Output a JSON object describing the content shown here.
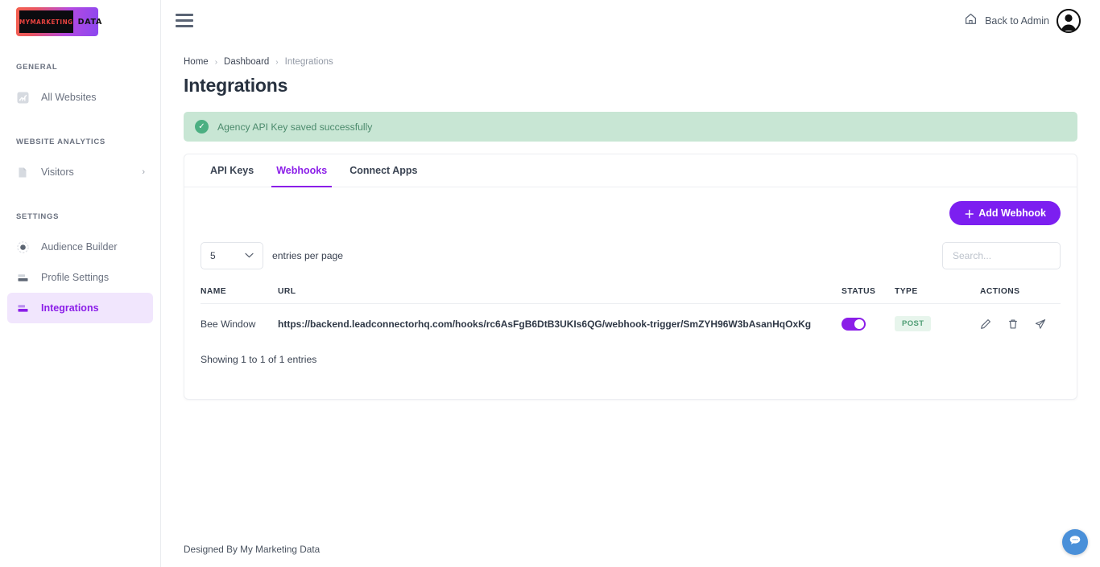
{
  "sidebar": {
    "logo": {
      "text_left": "MYMARKETING",
      "text_right": "DATA",
      "icon": "brand-logo"
    },
    "sections": [
      {
        "label": "GENERAL"
      },
      {
        "label": "WEBSITE ANALYTICS"
      },
      {
        "label": "SETTINGS"
      }
    ],
    "items": [
      {
        "label": "All Websites",
        "icon": "chart-icon",
        "active": false,
        "chevron": false
      },
      {
        "label": "Visitors",
        "icon": "page-icon",
        "active": false,
        "chevron": true
      },
      {
        "label": "Audience Builder",
        "icon": "target-icon",
        "active": false,
        "chevron": false
      },
      {
        "label": "Profile Settings",
        "icon": "profile-icon",
        "active": false,
        "chevron": false
      },
      {
        "label": "Integrations",
        "icon": "integrations-icon",
        "active": true,
        "chevron": false
      }
    ],
    "chevron_glyph": "›"
  },
  "topbar": {
    "menu_icon": "hamburger-icon",
    "back_to_admin": "Back to Admin",
    "home_icon": "home-icon",
    "avatar_icon": "user-avatar"
  },
  "breadcrumb": {
    "items": [
      {
        "label": "Home",
        "current": false
      },
      {
        "label": "Dashboard",
        "current": false
      },
      {
        "label": "Integrations",
        "current": true
      }
    ],
    "separator": "›"
  },
  "page": {
    "title": "Integrations"
  },
  "alert": {
    "message": "Agency API Key saved successfully",
    "icon": "check-circle-icon",
    "check_glyph": "✓",
    "bg_color": "#c8e6d4",
    "text_color": "#4b8a6c"
  },
  "tabs": [
    {
      "label": "API Keys",
      "active": false
    },
    {
      "label": "Webhooks",
      "active": true
    },
    {
      "label": "Connect Apps",
      "active": false
    }
  ],
  "toolbar": {
    "add_webhook_label": "Add Webhook",
    "add_webhook_plus": "＋",
    "accent_color": "#7c1ff0"
  },
  "table_controls": {
    "entries_value": "5",
    "entries_caret": "⌄",
    "entries_label": "entries per page",
    "search_placeholder": "Search...",
    "search_value": ""
  },
  "table": {
    "columns": [
      "NAME",
      "URL",
      "STATUS",
      "TYPE",
      "ACTIONS"
    ],
    "rows": [
      {
        "name": "Bee Window",
        "url": "https://backend.leadconnectorhq.com/hooks/rc6AsFgB6DtB3UKIs6QG/webhook-trigger/SmZYH96W3bAsanHqOxKg",
        "status_enabled": true,
        "type": "POST",
        "actions": [
          "edit-icon",
          "delete-icon",
          "send-icon"
        ]
      }
    ],
    "showing_text": "Showing 1 to 1 of 1 entries"
  },
  "footer": {
    "text": "Designed By My Marketing Data"
  },
  "chat": {
    "icon": "chat-bubble-icon",
    "color": "#4a90d9"
  }
}
